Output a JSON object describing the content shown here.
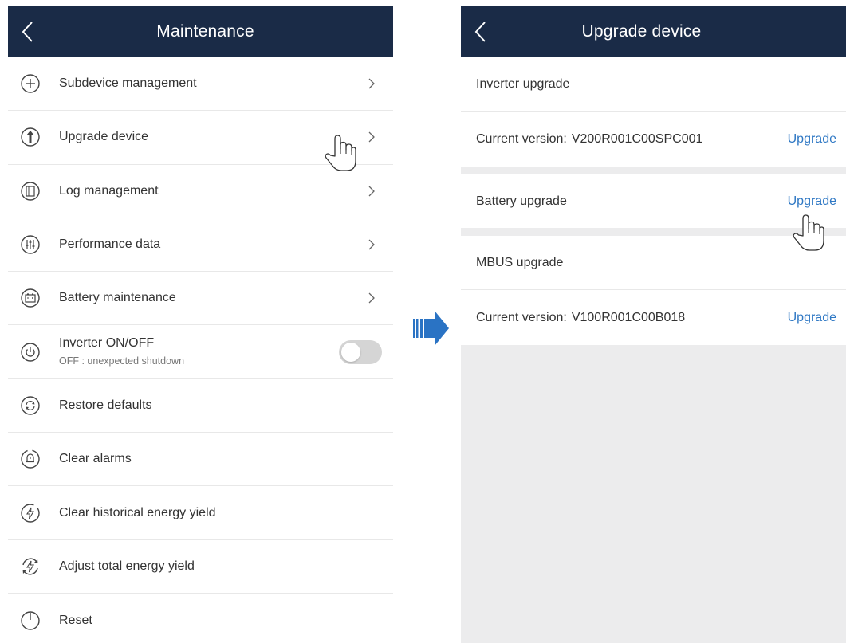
{
  "left": {
    "title": "Maintenance",
    "items": [
      {
        "label": "Subdevice management"
      },
      {
        "label": "Upgrade device"
      },
      {
        "label": "Log management"
      },
      {
        "label": "Performance data"
      },
      {
        "label": "Battery maintenance"
      },
      {
        "label": "Inverter ON/OFF",
        "sublabel": "OFF : unexpected shutdown",
        "toggle": "off"
      },
      {
        "label": "Restore defaults"
      },
      {
        "label": "Clear alarms"
      },
      {
        "label": "Clear historical energy yield"
      },
      {
        "label": "Adjust total energy yield"
      },
      {
        "label": "Reset"
      }
    ]
  },
  "right": {
    "title": "Upgrade device",
    "inverter": {
      "heading": "Inverter upgrade",
      "version_label": "Current version:",
      "version": "V200R001C00SPC001",
      "action": "Upgrade"
    },
    "battery": {
      "heading": "Battery upgrade",
      "action": "Upgrade"
    },
    "mbus": {
      "heading": "MBUS upgrade",
      "version_label": "Current version:",
      "version": "V100R001C00B018",
      "action": "Upgrade"
    }
  },
  "colors": {
    "header": "#1a2b47",
    "link": "#2f78c4",
    "arrow": "#2a73c4"
  }
}
